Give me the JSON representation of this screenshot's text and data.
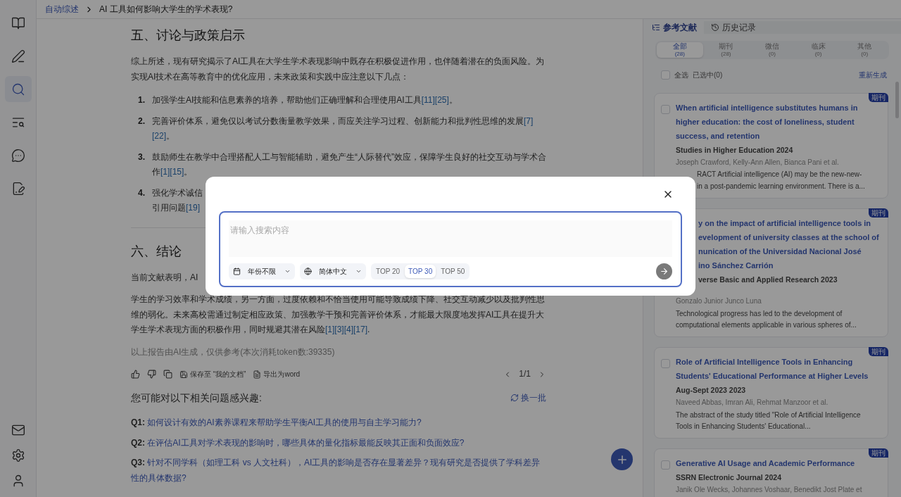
{
  "sidebar": {
    "items": [
      {
        "kind": "book",
        "selected": false
      },
      {
        "kind": "pen",
        "selected": false
      },
      {
        "kind": "search",
        "selected": true
      },
      {
        "kind": "text_search",
        "selected": false
      },
      {
        "kind": "chat",
        "selected": false
      },
      {
        "kind": "note",
        "selected": false
      }
    ],
    "bottom_items": [
      {
        "kind": "mail"
      },
      {
        "kind": "settings"
      },
      {
        "kind": "user"
      }
    ]
  },
  "breadcrumb": [
    "自动综述",
    "AI 工具如何影响大学生的学术表现?"
  ],
  "report": {
    "sections": [
      {
        "heading": "五、讨论与政策启示",
        "paragraphs": [
          {
            "text": "综上所述，现有研究揭示了AI工具在大学生学术表现影响中既存在积极促进作用，也伴随着潜在的负面风险。为实现AI技术在高等教育中的优化应用，未来政策和实践中应注意以下几点："
          }
        ],
        "list": [
          {
            "kind": "full",
            "number": "1.",
            "text": "加强学生AI技能和信息素养的培养，帮助他们正确理解和合理使用AI工具",
            "citations": [
              "[11]",
              "[25]"
            ],
            "end": "。"
          },
          {
            "kind": "full",
            "number": "2.",
            "text": "完善评价体系，避免仅以考试分数衡量教学效果，而应关注学习过程、创新能力和批判性思维的发展",
            "citations": [
              "[7]",
              "[22]"
            ],
            "end": "。"
          },
          {
            "kind": "full",
            "number": "3.",
            "text": "鼓励师生在教学中合理搭配人工与智能辅助，避免产生“人际替代”效应，保障学生良好的社交互动与学术合作",
            "citations": [
              "[1]",
              "[15]"
            ],
            "end": "。"
          },
          {
            "kind": "partly_hidden",
            "number": "4.",
            "fragments": [
              {
                "text": "强化学术诚信"
              },
              {
                "text": "引用问题",
                "citations": [
                  "[19]"
                ]
              }
            ]
          }
        ]
      },
      {
        "heading": "六、结论",
        "paragraphs": [
          {
            "text": "当前文献表明，AI"
          },
          {
            "text": "学生的学习效率和学术成绩，另一方面，过度依赖和不恰当使用可能导致成绩下降、社交互动减少以及批判性思维的弱化。未来高校需通过制定相应政策、加强教学干预和完善评价体系，才能最大限度地发挥AI工具在提升大学生学术表现方面的积极作用，同时规避其潜在风险",
            "citations": [
              "[1]",
              "[3]",
              "[4]",
              "[17]"
            ],
            "end": "."
          }
        ]
      }
    ],
    "note": "以上报告由AI生成，仅供参考(本次消耗token数:39335)",
    "actions": [
      {
        "kind": "like"
      },
      {
        "kind": "dislike"
      },
      {
        "kind": "copy"
      },
      {
        "kind": "save",
        "label": "保存至 “我的文档”"
      },
      {
        "kind": "word",
        "label": "导出为word"
      }
    ],
    "pager": "1/1",
    "related": {
      "title": "您可能对以下相关问题感兴趣:",
      "refresh": "换一批",
      "questions": [
        {
          "label": "Q1:",
          "text": "如何设计有效的AI素养课程来帮助学生平衡AI工具的使用与自主学习能力?"
        },
        {
          "label": "Q2:",
          "text": "在评估AI工具对学术表现的影响时，哪些具体的量化指标最能反映其正面和负面效应?"
        },
        {
          "label": "Q3:",
          "text": "针对不同学科（如理工科 vs 人文社科），AI工具的影响是否存在显著差异？现有研究是否提供了学科差异性的具体数据?"
        }
      ]
    }
  },
  "references_panel": {
    "tabs": [
      {
        "kind": "list",
        "label": "参考文献",
        "selected": true
      },
      {
        "kind": "history",
        "label": "历史记录",
        "selected": false
      }
    ],
    "filters": [
      {
        "label": "全部",
        "count": "(28)",
        "selected": true
      },
      {
        "label": "期刊",
        "count": "(28)",
        "selected": false
      },
      {
        "label": "微信",
        "count": "(0)",
        "selected": false
      },
      {
        "label": "临床",
        "count": "(0)",
        "selected": false
      },
      {
        "label": "其他",
        "count": "(0)",
        "selected": false
      }
    ],
    "select_all": {
      "label": "全选",
      "checked": false
    },
    "selected_count": "已选中(0)",
    "regenerate": "重新生成",
    "cards": [
      {
        "kind": "full",
        "badge": "期刊",
        "checked": false,
        "title": "When artificial intelligence substitutes humans in higher education: the cost of loneliness, student success, and retention",
        "journal": "Studies in Higher Education 2024",
        "authors": "Joseph Crawford, Kelly-Ann Allen, Bianca Pani et al.",
        "abstract_lines": [
          "RACT Artificial intelligence (AI) may be the new-new-",
          "in a post-pandemic learning environment. There is a..."
        ]
      },
      {
        "kind": "partly_hidden",
        "badge": "期刊",
        "title_lines": [
          "y on the impact of artificial intelligence tools in",
          "evelopment of university classes at the school of",
          "nunication of the Universidad Nacional José",
          "ino Sánchez Carrión"
        ],
        "journal": "verse Basic and Applied Research 2023",
        "authors": "Gonzalo Junior Junco Luna",
        "abstract": "Technological progress has led to the development of computational elements applicable in various spheres of..."
      },
      {
        "kind": "full",
        "badge": "期刊",
        "checked": false,
        "title": "Role of Artificial Intelligence Tools in Enhancing Students' Educational Performance at Higher Levels",
        "journal": "Aug-Sept 2023 2023",
        "authors": "Naveed Abbas, Imran Ali, Rehmat Manzoor et al.",
        "abstract": "The abstract of the study titled \"Role of Artificial Intelligence Tools in Enhancing Students' Educational..."
      },
      {
        "kind": "full",
        "badge": "期刊",
        "checked": false,
        "title": "Generative AI Usage and Academic Performance",
        "journal": "SSRN Electronic Journal 2024",
        "authors": "Janik Ole Wecks, Johannes Voshaar, Benedikt Jost Plate et"
      }
    ]
  },
  "search_dialog": {
    "placeholder": "请输入搜索内容",
    "year": "年份不限",
    "language": "简体中文",
    "top_options": [
      {
        "label": "TOP 20",
        "selected": false
      },
      {
        "label": "TOP 30",
        "selected": true
      },
      {
        "label": "TOP 50",
        "selected": false
      }
    ]
  }
}
